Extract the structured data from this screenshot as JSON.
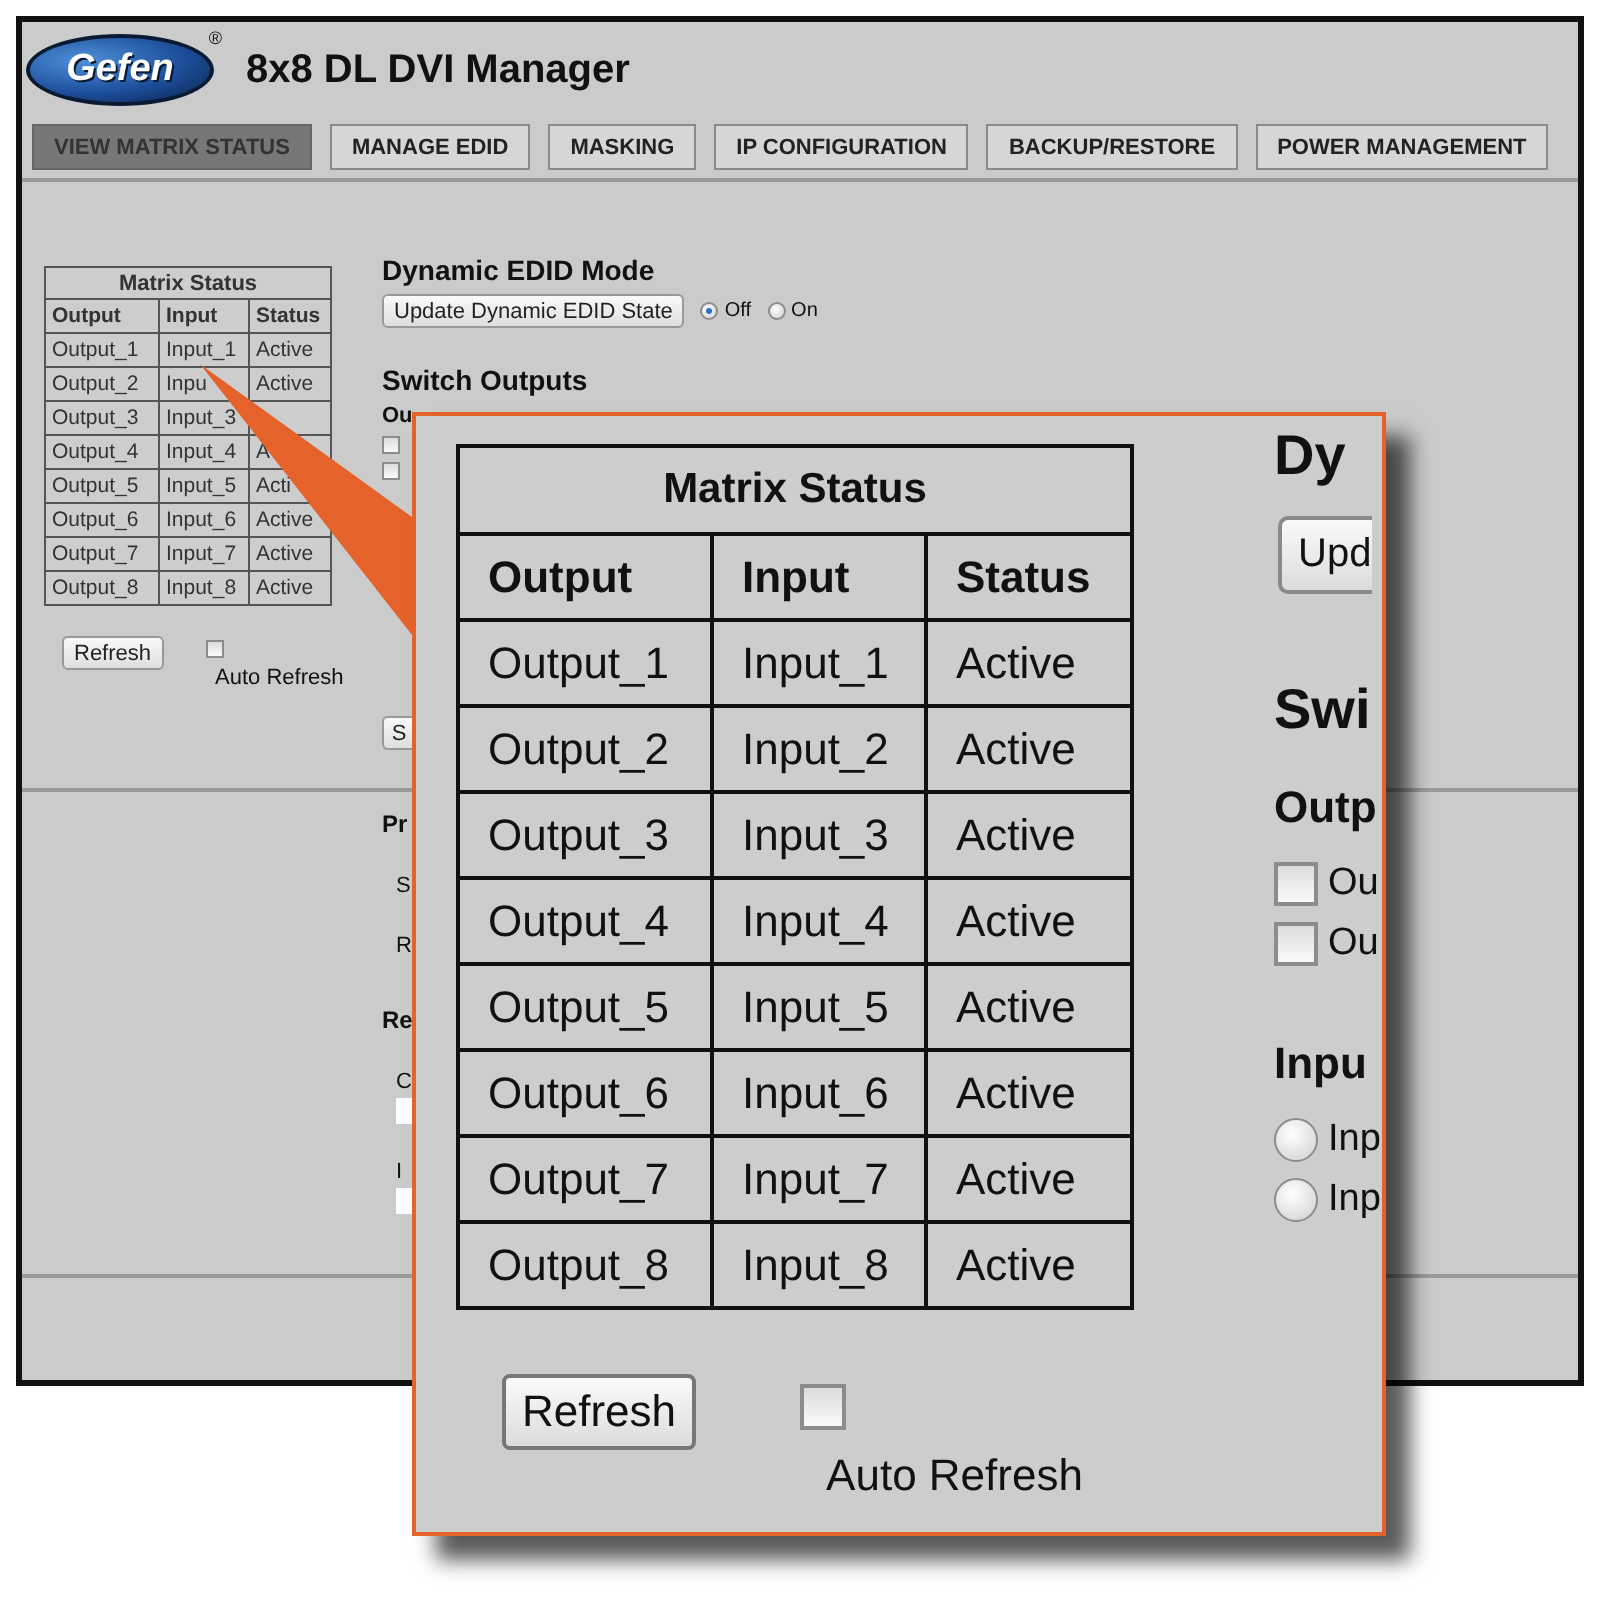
{
  "header": {
    "logo": "Gefen",
    "logo_mark": "®",
    "title": "8x8 DL DVI Manager"
  },
  "tabs": [
    {
      "label": "VIEW MATRIX STATUS",
      "selected": true
    },
    {
      "label": "MANAGE EDID",
      "selected": false
    },
    {
      "label": "MASKING",
      "selected": false
    },
    {
      "label": "IP CONFIGURATION",
      "selected": false
    },
    {
      "label": "BACKUP/RESTORE",
      "selected": false
    },
    {
      "label": "POWER MANAGEMENT",
      "selected": false
    }
  ],
  "matrix_status": {
    "title": "Matrix Status",
    "columns": [
      "Output",
      "Input",
      "Status"
    ],
    "rows": [
      {
        "output": "Output_1",
        "input": "Input_1",
        "status": "Active"
      },
      {
        "output": "Output_2",
        "input": "Inpu",
        "status": "Active"
      },
      {
        "output": "Output_3",
        "input": "Input_3"
      },
      {
        "output": "Output_4",
        "input": "Input_4",
        "status": "A"
      },
      {
        "output": "Output_5",
        "input": "Input_5",
        "status": "Acti"
      },
      {
        "output": "Output_6",
        "input": "Input_6",
        "status": "Active"
      },
      {
        "output": "Output_7",
        "input": "Input_7",
        "status": "Active"
      },
      {
        "output": "Output_8",
        "input": "Input_8",
        "status": "Active"
      }
    ]
  },
  "refresh_button": "Refresh",
  "auto_refresh": {
    "label": "Auto Refresh",
    "checked": false
  },
  "dynamic_edid": {
    "title": "Dynamic EDID Mode",
    "button": "Update Dynamic EDID State",
    "options": [
      {
        "label": "Off",
        "selected": true
      },
      {
        "label": "On",
        "selected": false
      }
    ]
  },
  "switch_outputs": {
    "title": "Switch Outputs",
    "outputs_label": "Ou",
    "outputs": [
      {
        "checked": false
      },
      {
        "checked": false
      }
    ],
    "switch_button": "S"
  },
  "lower_section": [
    {
      "kind": "heading",
      "text": "Pr"
    },
    {
      "kind": "label",
      "text": "S"
    },
    {
      "kind": "label",
      "text": "R"
    },
    {
      "kind": "heading",
      "text": "Re"
    },
    {
      "kind": "label",
      "text": "C"
    },
    {
      "kind": "field"
    },
    {
      "kind": "label",
      "text": "I"
    },
    {
      "kind": "field"
    }
  ],
  "callout": {
    "matrix_status": {
      "title": "Matrix Status",
      "columns": [
        "Output",
        "Input",
        "Status"
      ],
      "rows": [
        {
          "output": "Output_1",
          "input": "Input_1",
          "status": "Active"
        },
        {
          "output": "Output_2",
          "input": "Input_2",
          "status": "Active"
        },
        {
          "output": "Output_3",
          "input": "Input_3",
          "status": "Active"
        },
        {
          "output": "Output_4",
          "input": "Input_4",
          "status": "Active"
        },
        {
          "output": "Output_5",
          "input": "Input_5",
          "status": "Active"
        },
        {
          "output": "Output_6",
          "input": "Input_6",
          "status": "Active"
        },
        {
          "output": "Output_7",
          "input": "Input_7",
          "status": "Active"
        },
        {
          "output": "Output_8",
          "input": "Input_8",
          "status": "Active"
        }
      ]
    },
    "refresh_button": "Refresh",
    "auto_refresh": {
      "label": "Auto Refresh",
      "checked": false
    },
    "side": {
      "title": "Dy",
      "button": "Upd",
      "heading": "Swi",
      "outputs_label": "Outp",
      "outputs": [
        {
          "label": "Ou",
          "checked": false
        },
        {
          "label": "Ou",
          "checked": false
        }
      ],
      "inputs_label": "Inpu",
      "inputs": [
        {
          "label": "Inp",
          "selected": false
        },
        {
          "label": "Inp",
          "selected": false
        }
      ]
    }
  }
}
